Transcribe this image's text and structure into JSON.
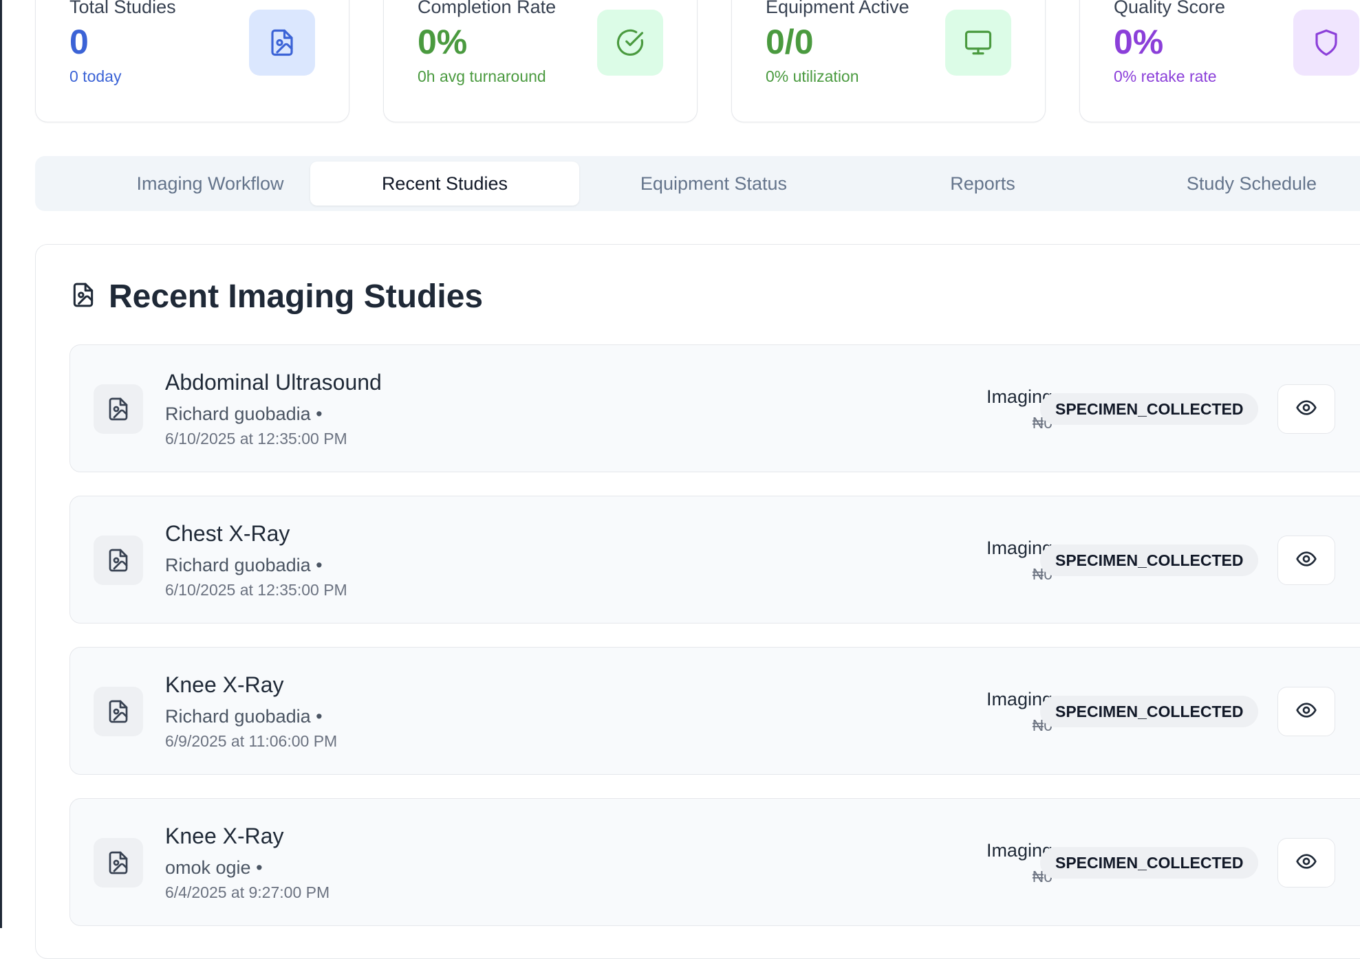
{
  "colors": {
    "blue": "#3b63d6",
    "green": "#4a9a3f",
    "purple": "#8b3fd9",
    "blue_bg": "#dbe7fe",
    "green_bg": "#dcfce7",
    "purple_bg": "#f0e5fe"
  },
  "stats": [
    {
      "label": "Total Studies",
      "value": "0",
      "sub": "0 today",
      "icon": "file-image-icon",
      "color": "blue"
    },
    {
      "label": "Completion Rate",
      "value": "0%",
      "sub": "0h avg turnaround",
      "icon": "check-circle-icon",
      "color": "green"
    },
    {
      "label": "Equipment Active",
      "value": "0/0",
      "sub": "0% utilization",
      "icon": "monitor-icon",
      "color": "green"
    },
    {
      "label": "Quality Score",
      "value": "0%",
      "sub": "0% retake rate",
      "icon": "shield-icon",
      "color": "purple"
    }
  ],
  "tabs": [
    {
      "label": "Imaging Workflow",
      "active": false
    },
    {
      "label": "Recent Studies",
      "active": true
    },
    {
      "label": "Equipment Status",
      "active": false
    },
    {
      "label": "Reports",
      "active": false
    },
    {
      "label": "Study Schedule",
      "active": false
    }
  ],
  "panel": {
    "title": "Recent Imaging Studies",
    "icon": "file-image-icon"
  },
  "studies": [
    {
      "name": "Abdominal Ultrasound",
      "patient": "Richard guobadia •",
      "date": "6/10/2025 at 12:35:00 PM",
      "type": "Imaging",
      "price": "₦0",
      "status": "SPECIMEN_COLLECTED"
    },
    {
      "name": "Chest X-Ray",
      "patient": "Richard guobadia •",
      "date": "6/10/2025 at 12:35:00 PM",
      "type": "Imaging",
      "price": "₦0",
      "status": "SPECIMEN_COLLECTED"
    },
    {
      "name": "Knee X-Ray",
      "patient": "Richard guobadia •",
      "date": "6/9/2025 at 11:06:00 PM",
      "type": "Imaging",
      "price": "₦0",
      "status": "SPECIMEN_COLLECTED"
    },
    {
      "name": "Knee X-Ray",
      "patient": "omok ogie •",
      "date": "6/4/2025 at 9:27:00 PM",
      "type": "Imaging",
      "price": "₦0",
      "status": "SPECIMEN_COLLECTED"
    }
  ]
}
